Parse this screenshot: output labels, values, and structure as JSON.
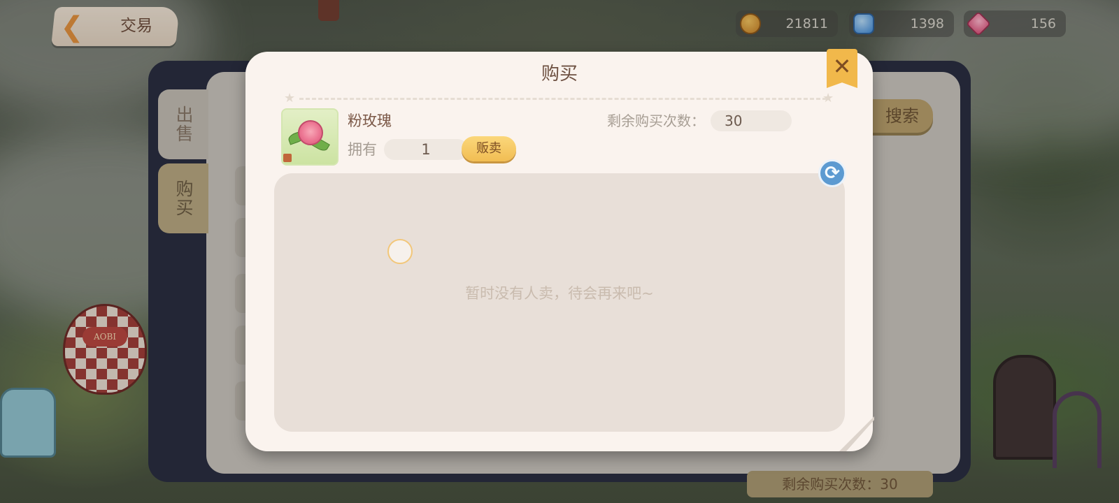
{
  "header": {
    "back_title": "交易",
    "currencies": [
      {
        "name": "coin",
        "value": "21811",
        "color": "#d7962c"
      },
      {
        "name": "blue-token",
        "value": "1398",
        "color": "#3b86d4"
      },
      {
        "name": "pink-gem",
        "value": "156",
        "color": "#d84873"
      }
    ]
  },
  "trade_panel": {
    "tab_sell": "出售",
    "tab_buy": "购买",
    "search_label": "搜索",
    "bottom_remaining": "剩余购买次数：30"
  },
  "dialog": {
    "title": "购买",
    "item_name": "粉玫瑰",
    "remaining_label": "剩余购买次数：",
    "remaining_value": "30",
    "own_label": "拥有",
    "own_value": "1",
    "sell_button": "贩卖",
    "empty_message": "暂时没有人卖，待会再来吧~",
    "refresh_icon": "refresh-icon",
    "close_icon": "close-icon",
    "accent_color": "#f1b84b"
  },
  "scene": {
    "balloon_label": "AOBI"
  }
}
